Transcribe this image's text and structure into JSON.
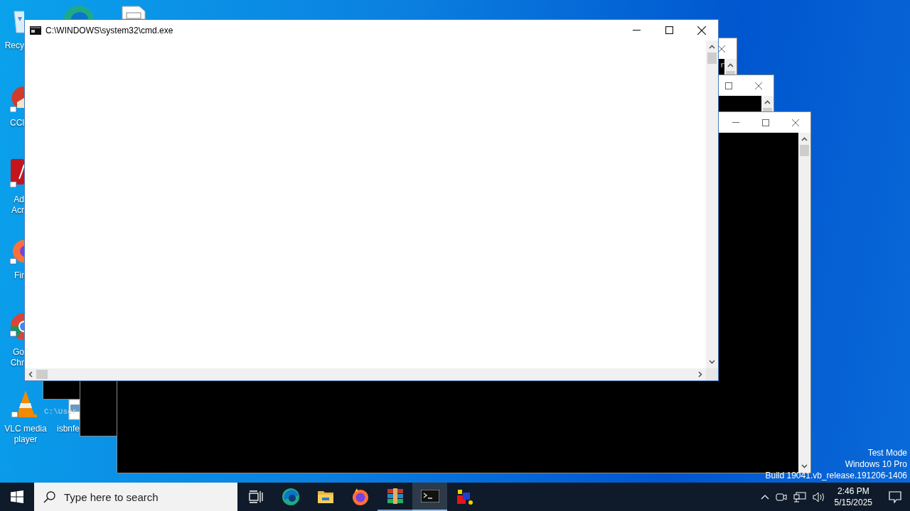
{
  "desktop": {
    "icons": [
      {
        "kind": "recycle-bin",
        "lines": [
          "Recy"
        ]
      },
      {
        "kind": "ccleaner",
        "lines": [
          "CCl"
        ]
      },
      {
        "kind": "acrobat",
        "lines": [
          "Ad",
          "Acr"
        ]
      },
      {
        "kind": "firefox",
        "lines": [
          "Fir"
        ]
      },
      {
        "kind": "chrome",
        "lines": [
          "Go",
          "Chr"
        ]
      },
      {
        "kind": "vlc",
        "lines": [
          "VLC media",
          "player"
        ]
      },
      {
        "kind": "image-file",
        "lines": [
          "isbnfe"
        ]
      },
      {
        "kind": "edge"
      },
      {
        "kind": "document"
      }
    ],
    "system_notice": [
      "Test Mode",
      "Windows 10 Pro",
      "Build 19041.vb_release.191206-1406"
    ]
  },
  "background_windows": [
    {
      "controls": [
        {
          "kind": "close"
        }
      ],
      "console_lines": [
        "r",
        "C:\\User"
      ]
    },
    {
      "controls": [
        {
          "kind": "maximize"
        },
        {
          "kind": "close"
        }
      ]
    },
    {
      "controls": [
        {
          "kind": "minimize"
        },
        {
          "kind": "maximize"
        },
        {
          "kind": "close"
        }
      ]
    }
  ],
  "window": {
    "title": "C:\\WINDOWS\\system32\\cmd.exe",
    "controls": [
      {
        "kind": "minimize"
      },
      {
        "kind": "maximize"
      },
      {
        "kind": "close"
      }
    ]
  },
  "taskbar": {
    "search": {
      "placeholder": "Type here to search"
    },
    "apps": [
      {
        "kind": "task-view",
        "running": false,
        "active": false
      },
      {
        "kind": "edge",
        "running": false,
        "active": false
      },
      {
        "kind": "folder",
        "running": false,
        "active": false
      },
      {
        "kind": "firefox",
        "running": false,
        "active": false
      },
      {
        "kind": "archive",
        "running": true,
        "active": false
      },
      {
        "kind": "console",
        "running": true,
        "active": true
      },
      {
        "kind": "cubes",
        "running": false,
        "active": false
      }
    ],
    "tray": {
      "time": "2:46 PM",
      "date": "5/15/2025"
    }
  }
}
